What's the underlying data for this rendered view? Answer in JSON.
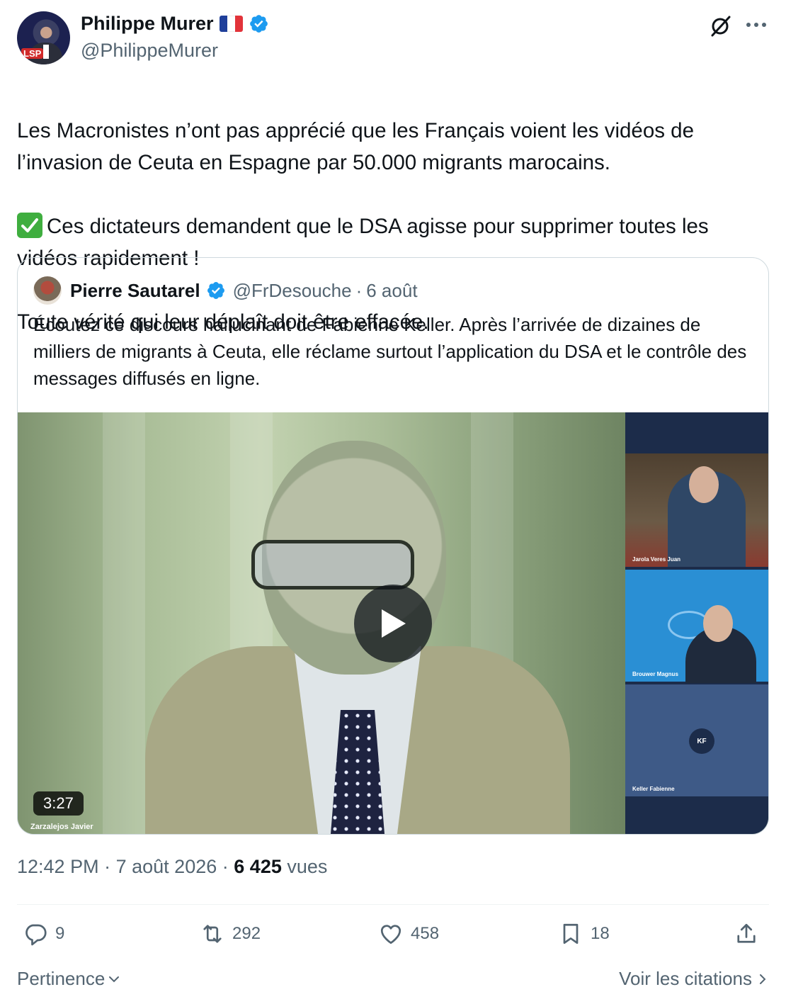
{
  "author": {
    "name": "Philippe Murer",
    "handle": "@PhilippeMurer",
    "flag_colors": [
      "#1f3f9a",
      "#ffffff",
      "#e2333a"
    ],
    "verified_color": "#1d9bf0",
    "avatar_text": "LSP"
  },
  "tweet": {
    "lines": [
      "Les Macronistes n’ont pas apprécié que les Français voient les vidéos de l’invasion de Ceuta en Espagne par 50.000 migrants marocains.",
      "Ces dictateurs demandent que le DSA agisse pour supprimer toutes les vidéos rapidement !",
      "Toute vérité qui leur déplaît doit être effacée."
    ]
  },
  "quote": {
    "name": "Pierre Sautarel",
    "handle": "@FrDesouche",
    "separator": "·",
    "date": "6 août",
    "text": "Écoutez ce discours hallucinant de Fabienne Keller. Après l’arrivée de dizaines de milliers de migrants à Ceuta, elle réclame surtout l’application du DSA et le contrôle des messages diffusés en ligne.",
    "video": {
      "duration": "3:27",
      "main_caption": "Zarzalejos Javier",
      "tile1_label": "Jarola Veres Juan",
      "tile2_label": "Brouwer Magnus",
      "tile3_initials": "KF",
      "tile3_label": "Keller Fabienne"
    }
  },
  "meta": {
    "time": "12:42 PM",
    "separator": "·",
    "date": "7 août 2026",
    "views_count": "6 425",
    "views_label": "vues"
  },
  "actions": {
    "replies": "9",
    "reposts": "292",
    "likes": "458",
    "bookmarks": "18"
  },
  "footer": {
    "sort_label": "Pertinence",
    "quotes_label": "Voir les citations"
  },
  "colors": {
    "text_primary": "#0f1419",
    "text_secondary": "#536471",
    "border": "#cfd9de",
    "verified": "#1d9bf0"
  },
  "icons": [
    "grok-icon",
    "more-icon",
    "verified-icon",
    "check-emoji-icon",
    "play-icon",
    "reply-icon",
    "repost-icon",
    "like-icon",
    "bookmark-icon",
    "share-icon",
    "chevron-down-icon",
    "chevron-right-icon"
  ]
}
